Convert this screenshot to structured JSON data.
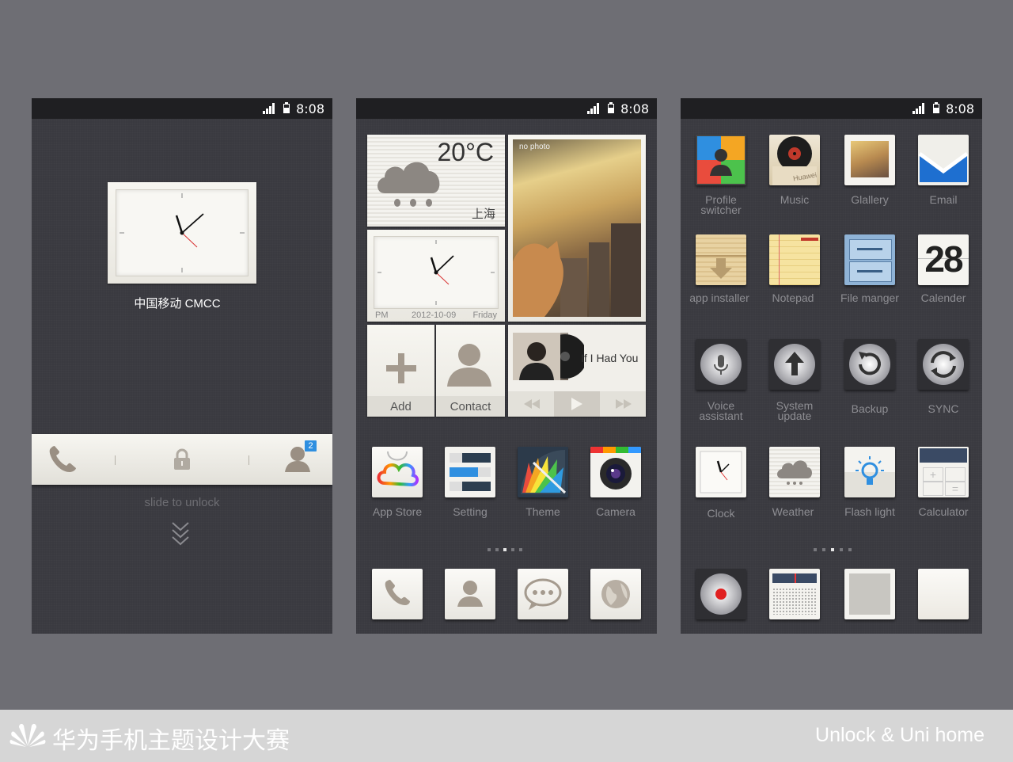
{
  "status": {
    "time": "8:08"
  },
  "lock": {
    "carrier": "中国移动  CMCC",
    "slide_text": "slide to unlock",
    "badge_count": "2"
  },
  "home": {
    "weather": {
      "temp": "20°C",
      "city": "上海"
    },
    "clock": {
      "ampm": "PM",
      "date": "2012-10-09",
      "weekday": "Friday"
    },
    "photo": {
      "caption": "no photo"
    },
    "add_label": "Add",
    "contact_label": "Contact",
    "music": {
      "title": "If I Had You"
    },
    "apps": [
      "App Store",
      "Setting",
      "Theme",
      "Camera"
    ]
  },
  "apps_screen": {
    "rows": [
      [
        "Profile switcher",
        "Music",
        "Glallery",
        "Email"
      ],
      [
        "app installer",
        "Notepad",
        "File manger",
        "Calender"
      ],
      [
        "Voice assistant",
        "System update",
        "Backup",
        "SYNC"
      ],
      [
        "Clock",
        "Weather",
        "Flash light",
        "Calculator"
      ]
    ],
    "calendar_day": "28",
    "music_brand": "Huawei"
  },
  "footer": {
    "brand": "华为手机主题设计大赛",
    "subtitle": "Unlock & Uni home"
  },
  "colors": {
    "accent_blue": "#2f8fe0",
    "dark_bg": "#3a3a40",
    "status_bar": "#1f1f22"
  }
}
